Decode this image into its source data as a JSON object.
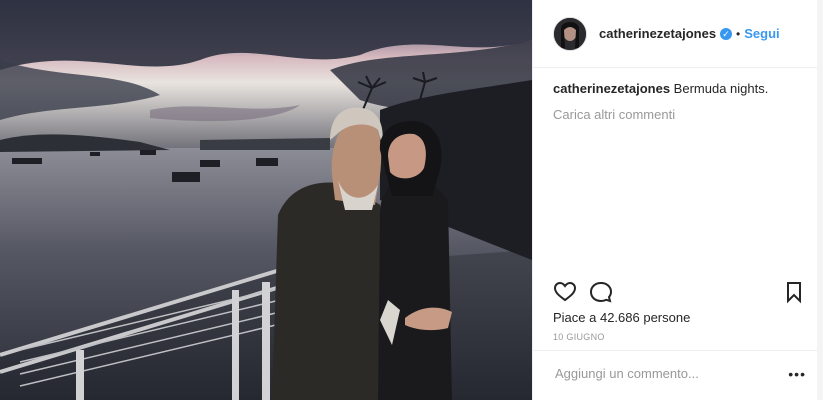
{
  "post": {
    "username": "catherinezetajones",
    "verified_icon": "verified-badge-icon",
    "separator": "•",
    "follow_label": "Segui",
    "caption_user": "catherinezetajones",
    "caption_text": "Bermuda nights.",
    "load_more": "Carica altri commenti",
    "likes_text": "Piace a 42.686 persone",
    "date": "10 GIUGNO",
    "comment_placeholder": "Aggiungi un commento...",
    "options_label": "•••"
  },
  "icons": [
    "like-heart-icon",
    "comment-bubble-icon",
    "bookmark-icon",
    "verified-badge-icon",
    "more-options-icon"
  ],
  "colors": {
    "link": "#3897f0",
    "text": "#262626",
    "muted": "#999999",
    "border": "#efefef"
  }
}
